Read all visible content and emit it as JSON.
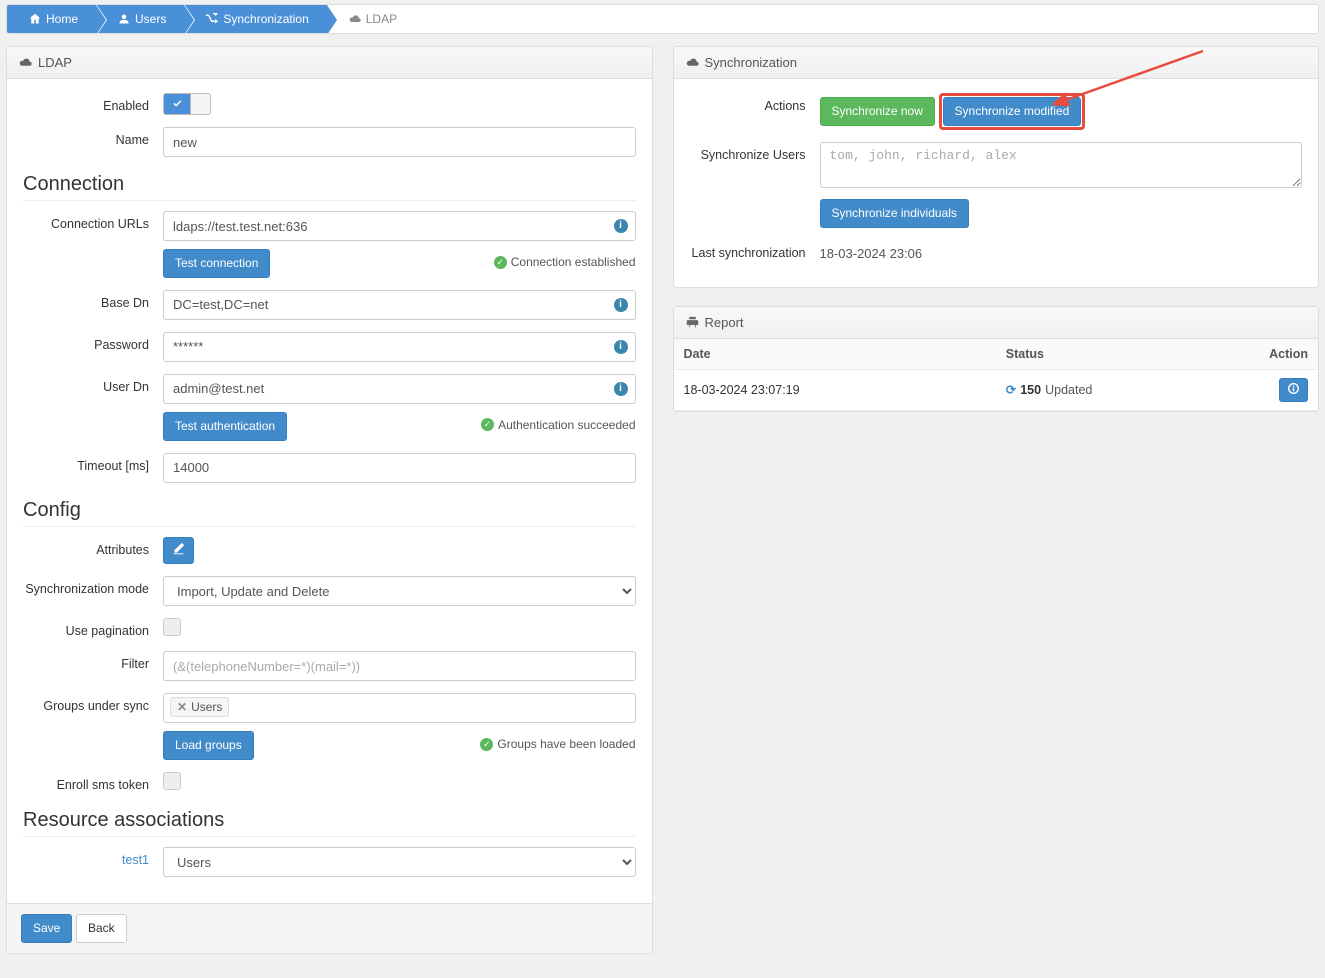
{
  "breadcrumb": {
    "home": "Home",
    "users": "Users",
    "sync": "Synchronization",
    "ldap": "LDAP"
  },
  "leftPanel": {
    "headingIcon": "cloud",
    "heading": "LDAP",
    "enabledLabel": "Enabled",
    "nameLabel": "Name",
    "nameValue": "new",
    "connectionTitle": "Connection",
    "connUrlsLabel": "Connection URLs",
    "connUrlsValue": "ldaps://test.test.net:636",
    "testConnBtn": "Test connection",
    "connEstablished": "Connection established",
    "baseDnLabel": "Base Dn",
    "baseDnValue": "DC=test,DC=net",
    "passwordLabel": "Password",
    "passwordValue": "******",
    "userDnLabel": "User Dn",
    "userDnValue": "admin@test.net",
    "testAuthBtn": "Test authentication",
    "authSucceeded": "Authentication succeeded",
    "timeoutLabel": "Timeout [ms]",
    "timeoutValue": "14000",
    "configTitle": "Config",
    "attributesLabel": "Attributes",
    "syncModeLabel": "Synchronization mode",
    "syncModeValue": "Import, Update and Delete",
    "usePaginationLabel": "Use pagination",
    "filterLabel": "Filter",
    "filterPlaceholder": "(&(telephoneNumber=*)(mail=*))",
    "groupsLabel": "Groups under sync",
    "groupTag": "Users",
    "loadGroupsBtn": "Load groups",
    "groupsLoaded": "Groups have been loaded",
    "enrollSmsLabel": "Enroll sms token",
    "resourceTitle": "Resource associations",
    "test1Label": "test1",
    "test1Value": "Users",
    "saveBtn": "Save",
    "backBtn": "Back"
  },
  "syncPanel": {
    "heading": "Synchronization",
    "actionsLabel": "Actions",
    "syncNowBtn": "Synchronize now",
    "syncModBtn": "Synchronize modified",
    "syncUsersLabel": "Synchronize Users",
    "syncUsersPlaceholder": "tom, john, richard, alex",
    "syncIndBtn": "Synchronize individuals",
    "lastSyncLabel": "Last synchronization",
    "lastSyncValue": "18-03-2024 23:06"
  },
  "reportPanel": {
    "heading": "Report",
    "colDate": "Date",
    "colStatus": "Status",
    "colAction": "Action",
    "row": {
      "date": "18-03-2024 23:07:19",
      "count": "150",
      "statusText": "Updated"
    }
  }
}
